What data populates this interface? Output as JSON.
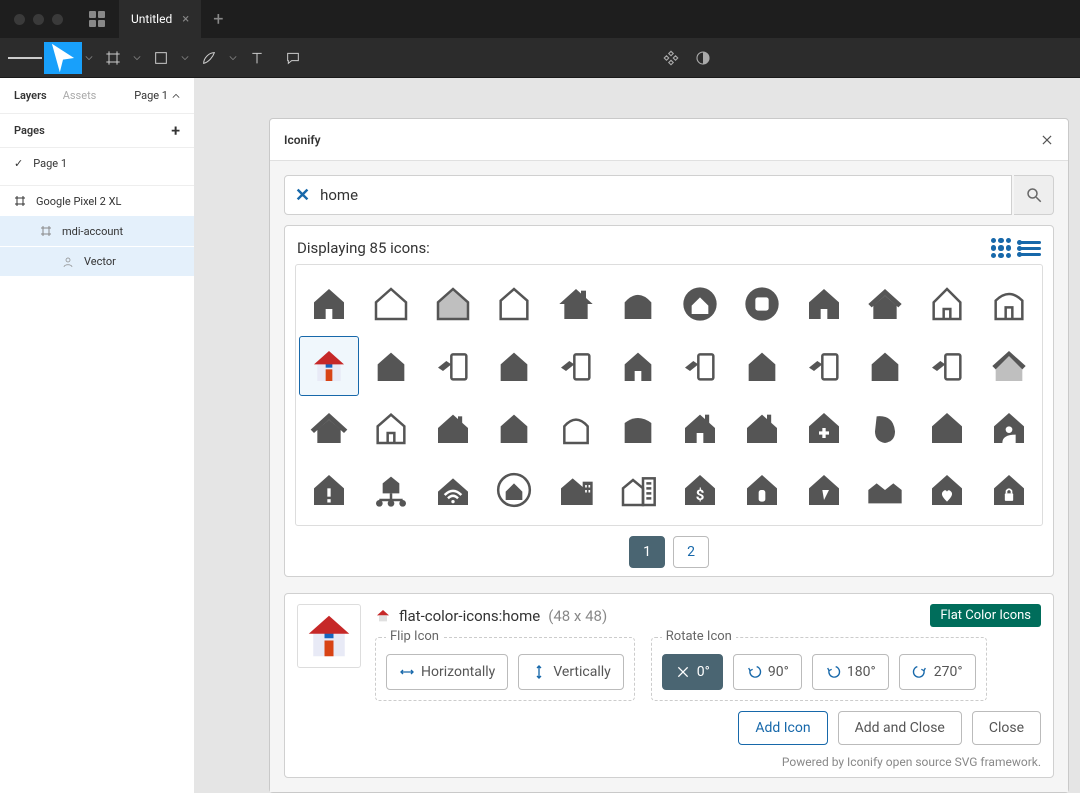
{
  "tab_title": "Untitled",
  "sidebar": {
    "tab_layers": "Layers",
    "tab_assets": "Assets",
    "page_dropdown": "Page 1",
    "pages_header": "Pages",
    "page_item": "Page 1",
    "frame_item": "Google Pixel 2 XL",
    "layer_item1": "mdi-account",
    "layer_item2": "Vector"
  },
  "panel": {
    "title": "Iconify",
    "search_value": "home",
    "result_line": "Displaying 85 icons:",
    "page1": "1",
    "page2": "2"
  },
  "detail": {
    "icon_id": "flat-color-icons:home",
    "dims": "(48 x 48)",
    "badge": "Flat Color Icons",
    "flip_legend": "Flip Icon",
    "flip_h": "Horizontally",
    "flip_v": "Vertically",
    "rotate_legend": "Rotate Icon",
    "rot0": "0°",
    "rot90": "90°",
    "rot180": "180°",
    "rot270": "270°",
    "add": "Add Icon",
    "addclose": "Add and Close",
    "close": "Close",
    "footer": "Powered by Iconify open source SVG framework."
  }
}
